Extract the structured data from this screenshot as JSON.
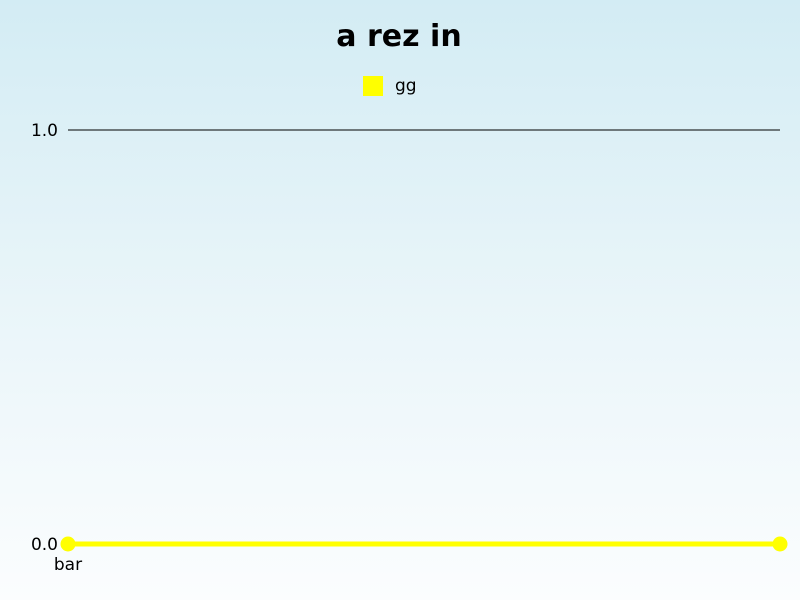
{
  "chart_data": {
    "type": "line",
    "title": "a rez in",
    "xlabel": "",
    "ylabel": "",
    "categories": [
      "bar",
      ""
    ],
    "series": [
      {
        "name": "gg",
        "color": "#ffff00",
        "values": [
          0.0,
          0.0
        ]
      }
    ],
    "ylim": [
      0.0,
      1.0
    ],
    "yticks": [
      "0.0",
      "1.0"
    ],
    "grid": true,
    "legend_position": "top-center",
    "marker": "circle"
  }
}
